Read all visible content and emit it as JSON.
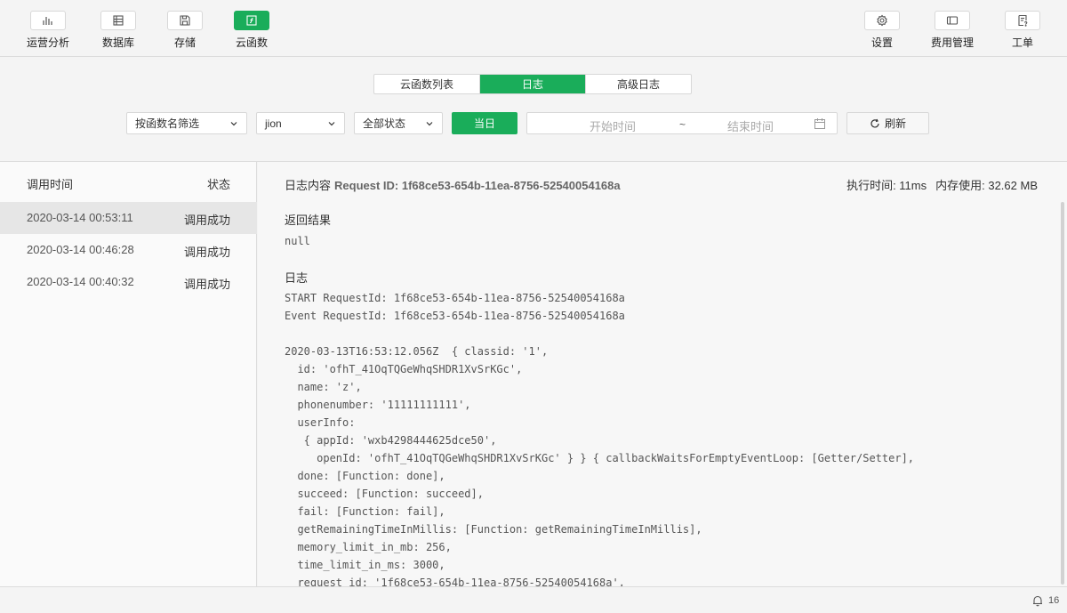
{
  "toolbar": {
    "left": [
      {
        "label": "运营分析",
        "icon": "bar-chart-icon"
      },
      {
        "label": "数据库",
        "icon": "database-icon"
      },
      {
        "label": "存储",
        "icon": "storage-icon"
      },
      {
        "label": "云函数",
        "icon": "cloud-function-icon",
        "active": true
      }
    ],
    "right": [
      {
        "label": "设置",
        "icon": "gear-icon"
      },
      {
        "label": "费用管理",
        "icon": "billing-icon"
      },
      {
        "label": "工单",
        "icon": "ticket-icon"
      }
    ]
  },
  "tabs": [
    "云函数列表",
    "日志",
    "高级日志"
  ],
  "active_tab": "日志",
  "filters": {
    "function_filter": "按函数名筛选",
    "env": "jion",
    "status": "全部状态",
    "today": "当日",
    "start_placeholder": "开始时间",
    "separator": "~",
    "end_placeholder": "结束时间",
    "refresh": "刷新"
  },
  "list": {
    "col_time": "调用时间",
    "col_status": "状态",
    "rows": [
      {
        "time": "2020-03-14 00:53:11",
        "status": "调用成功"
      },
      {
        "time": "2020-03-14 00:46:28",
        "status": "调用成功"
      },
      {
        "time": "2020-03-14 00:40:32",
        "status": "调用成功"
      }
    ]
  },
  "detail": {
    "title": "日志内容",
    "request_id": "Request ID: 1f68ce53-654b-11ea-8756-52540054168a",
    "exec_time": "执行时间: 11ms",
    "memory": "内存使用: 32.62 MB",
    "result_title": "返回结果",
    "result_value": "null",
    "log_title": "日志",
    "log_lines": [
      "START RequestId: 1f68ce53-654b-11ea-8756-52540054168a",
      "Event RequestId: 1f68ce53-654b-11ea-8756-52540054168a",
      "",
      "2020-03-13T16:53:12.056Z  { classid: '1',",
      "  id: 'ofhT_41OqTQGeWhqSHDR1XvSrKGc',",
      "  name: 'z',",
      "  phonenumber: '11111111111',",
      "  userInfo:",
      "   { appId: 'wxb4298444625dce50',",
      "     openId: 'ofhT_41OqTQGeWhqSHDR1XvSrKGc' } } { callbackWaitsForEmptyEventLoop: [Getter/Setter],",
      "  done: [Function: done],",
      "  succeed: [Function: succeed],",
      "  fail: [Function: fail],",
      "  getRemainingTimeInMillis: [Function: getRemainingTimeInMillis],",
      "  memory_limit_in_mb: 256,",
      "  time_limit_in_ms: 3000,",
      "  request_id: '1f68ce53-654b-11ea-8756-52540054168a',"
    ]
  },
  "statusbar": {
    "notifications": "16"
  }
}
